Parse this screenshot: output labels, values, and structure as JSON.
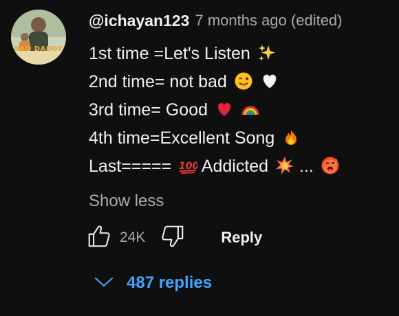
{
  "comment": {
    "author": "@ichayan123",
    "timestamp": "7 months ago (edited)",
    "avatar_text": "BRO DADDY",
    "lines": [
      {
        "text": "1st time =Let's Listen",
        "emojis": [
          "sparkles"
        ]
      },
      {
        "text": "2nd time= not bad",
        "emojis": [
          "winking-tongue-face",
          "white-heart"
        ]
      },
      {
        "text": "3rd time= Good",
        "emojis": [
          "red-heart",
          "rainbow"
        ]
      },
      {
        "text": "4th time=Excellent Song",
        "emojis": [
          "fire"
        ]
      },
      {
        "text": "Last=====",
        "emojis": [
          "hundred-points"
        ],
        "text2": "Addicted",
        "emojis2": [
          "collision"
        ],
        "text3": "...",
        "emojis3": [
          "hot-face"
        ]
      }
    ],
    "show_less_label": "Show less"
  },
  "actions": {
    "like_icon": "thumbs-up-icon",
    "like_count": "24K",
    "dislike_icon": "thumbs-down-icon",
    "reply_label": "Reply"
  },
  "replies": {
    "icon": "chevron-down-icon",
    "label": "487 replies"
  },
  "colors": {
    "background": "#0f0f0f",
    "text_primary": "#f1f1f1",
    "text_secondary": "#aaaaaa",
    "link_blue": "#3ea6ff"
  }
}
